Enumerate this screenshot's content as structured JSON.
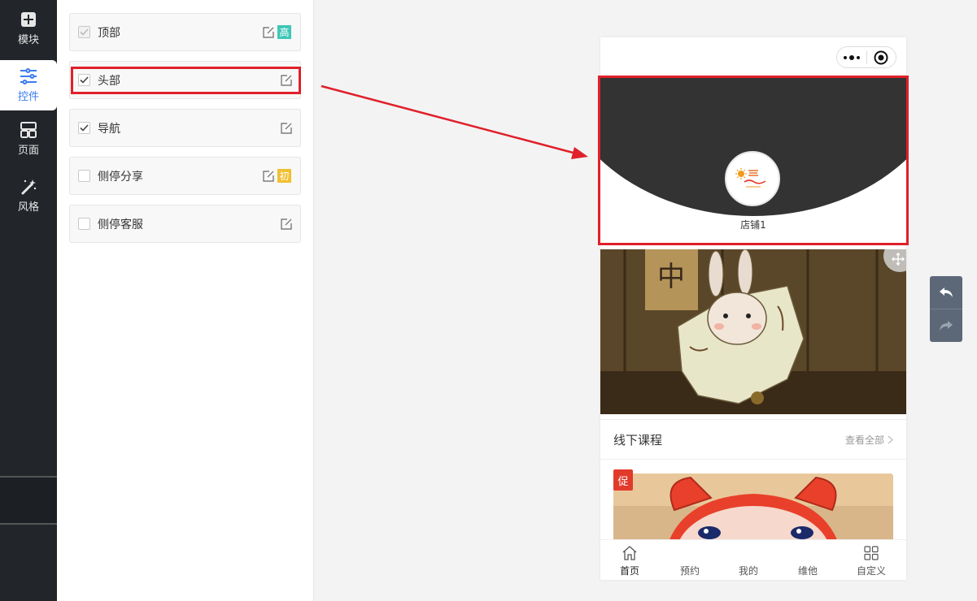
{
  "rail": {
    "items": [
      {
        "label": "模块",
        "icon": "plus-square-icon"
      },
      {
        "label": "控件",
        "icon": "sliders-icon"
      },
      {
        "label": "页面",
        "icon": "page-layout-icon"
      },
      {
        "label": "风格",
        "icon": "magic-wand-icon"
      }
    ]
  },
  "panel": {
    "components": [
      {
        "label": "顶部",
        "checked": true,
        "disabled": true,
        "badge": "高",
        "badge_color": "#3ec7b6"
      },
      {
        "label": "头部",
        "checked": true,
        "disabled": false,
        "badge": "",
        "badge_color": ""
      },
      {
        "label": "导航",
        "checked": true,
        "disabled": false,
        "badge": "",
        "badge_color": ""
      },
      {
        "label": "侧停分享",
        "checked": false,
        "disabled": false,
        "badge": "初",
        "badge_color": "#f0c030"
      },
      {
        "label": "侧停客服",
        "checked": false,
        "disabled": false,
        "badge": "",
        "badge_color": ""
      }
    ]
  },
  "preview": {
    "store_name": "店铺1",
    "section": {
      "title": "线下课程",
      "more": "查看全部"
    },
    "promo_tag": "促",
    "tabs": [
      {
        "label": "首页",
        "icon": "home-icon"
      },
      {
        "label": "预约",
        "icon": ""
      },
      {
        "label": "我的",
        "icon": ""
      },
      {
        "label": "维他",
        "icon": ""
      },
      {
        "label": "自定义",
        "icon": "grid-icon"
      }
    ]
  },
  "colors": {
    "accent": "#3b7cf0",
    "highlight": "#e0202a",
    "rail_bg": "#22252a",
    "header_bg": "#333333"
  }
}
